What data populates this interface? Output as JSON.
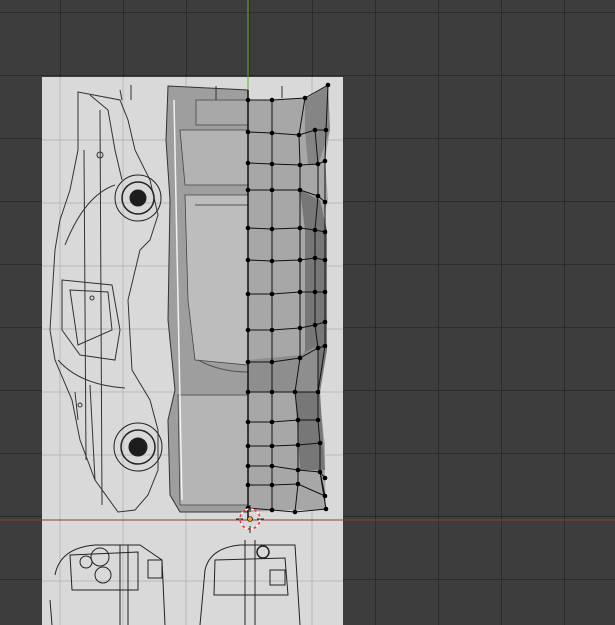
{
  "viewport": {
    "grid_color": "#2f2f2f",
    "background_color": "#3d3d3d",
    "y_axis_color": "#5fae2a",
    "x_axis_color": "#8a3a3a",
    "reference_image_color": "#d9d9d9",
    "mesh_face_color": "#a7a7a7",
    "mesh_edge_color": "#111111",
    "vertex_color": "#000000",
    "cursor_icon": "3d-cursor-icon"
  }
}
